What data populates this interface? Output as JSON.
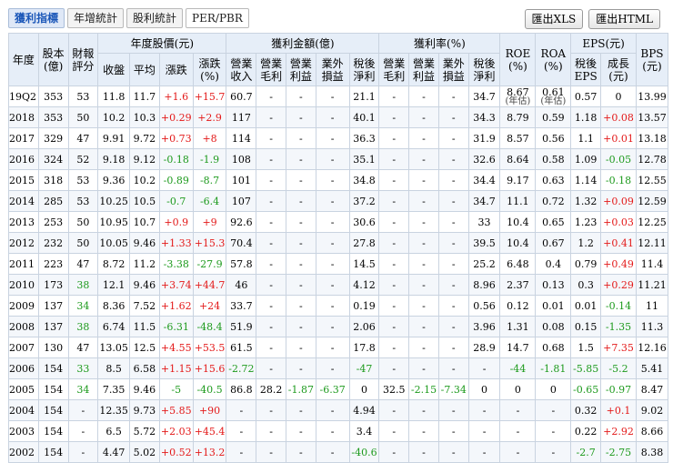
{
  "tabs": [
    {
      "label": "獲利指標",
      "active": true
    },
    {
      "label": "年增統計",
      "active": false
    },
    {
      "label": "股利統計",
      "active": false
    },
    {
      "label": "PER/PBR",
      "active": false
    }
  ],
  "actions": {
    "xls_label": "匯出XLS",
    "html_label": "匯出HTML"
  },
  "header": {
    "year": "年度",
    "capital": [
      "股本",
      "(億)"
    ],
    "rating": [
      "財報",
      "評分"
    ],
    "price_group": "年度股價(元)",
    "price_close": "收盤",
    "price_avg": "平均",
    "price_chg": "漲跌",
    "price_pct": [
      "漲跌",
      "(%)"
    ],
    "profit_group": "獲利金額(億)",
    "profit_rate_group": "獲利率(%)",
    "revenue": [
      "營業",
      "收入"
    ],
    "gross": [
      "營業",
      "毛利"
    ],
    "op": [
      "營業",
      "利益"
    ],
    "nonop": [
      "業外",
      "損益"
    ],
    "net": [
      "稅後",
      "淨利"
    ],
    "gross_r": [
      "營業",
      "毛利"
    ],
    "op_r": [
      "營業",
      "利益"
    ],
    "nonop_r": [
      "業外",
      "損益"
    ],
    "net_r": [
      "稅後",
      "淨利"
    ],
    "roe": [
      "ROE",
      "(%)"
    ],
    "roa": [
      "ROA",
      "(%)"
    ],
    "eps_group": "EPS(元)",
    "eps": [
      "稅後",
      "EPS"
    ],
    "eps_growth": [
      "成長",
      "(元)"
    ],
    "bps": [
      "BPS",
      "(元)"
    ]
  },
  "table": {
    "rows": [
      [
        "19Q2",
        "353",
        "53",
        "11.8",
        "11.7",
        "+1.6",
        "+15.7",
        "60.7",
        "-",
        "-",
        "-",
        "21.1",
        "-",
        "-",
        "-",
        "34.7",
        "8.67|(年估)",
        "0.61|(年估)",
        "0.57",
        "0",
        "13.99"
      ],
      [
        "2018",
        "353",
        "50",
        "10.2",
        "10.3",
        "+0.29",
        "+2.9",
        "117",
        "-",
        "-",
        "-",
        "40.1",
        "-",
        "-",
        "-",
        "34.3",
        "8.79",
        "0.59",
        "1.18",
        "+0.08",
        "13.57"
      ],
      [
        "2017",
        "329",
        "47",
        "9.91",
        "9.72",
        "+0.73",
        "+8",
        "114",
        "-",
        "-",
        "-",
        "36.3",
        "-",
        "-",
        "-",
        "31.9",
        "8.57",
        "0.56",
        "1.1",
        "+0.01",
        "13.18"
      ],
      [
        "2016",
        "324",
        "52",
        "9.18",
        "9.12",
        "-0.18",
        "-1.9",
        "108",
        "-",
        "-",
        "-",
        "35.1",
        "-",
        "-",
        "-",
        "32.6",
        "8.64",
        "0.58",
        "1.09",
        "-0.05",
        "12.78"
      ],
      [
        "2015",
        "318",
        "53",
        "9.36",
        "10.2",
        "-0.89",
        "-8.7",
        "101",
        "-",
        "-",
        "-",
        "34.8",
        "-",
        "-",
        "-",
        "34.4",
        "9.17",
        "0.63",
        "1.14",
        "-0.18",
        "12.55"
      ],
      [
        "2014",
        "285",
        "53",
        "10.25",
        "10.5",
        "-0.7",
        "-6.4",
        "107",
        "-",
        "-",
        "-",
        "37.2",
        "-",
        "-",
        "-",
        "34.7",
        "11.1",
        "0.72",
        "1.32",
        "+0.09",
        "12.59"
      ],
      [
        "2013",
        "253",
        "50",
        "10.95",
        "10.7",
        "+0.9",
        "+9",
        "92.6",
        "-",
        "-",
        "-",
        "30.6",
        "-",
        "-",
        "-",
        "33",
        "10.4",
        "0.65",
        "1.23",
        "+0.03",
        "12.25"
      ],
      [
        "2012",
        "232",
        "50",
        "10.05",
        "9.46",
        "+1.33",
        "+15.3",
        "70.4",
        "-",
        "-",
        "-",
        "27.8",
        "-",
        "-",
        "-",
        "39.5",
        "10.4",
        "0.67",
        "1.2",
        "+0.41",
        "12.11"
      ],
      [
        "2011",
        "223",
        "47",
        "8.72",
        "11.2",
        "-3.38",
        "-27.9",
        "57.8",
        "-",
        "-",
        "-",
        "14.5",
        "-",
        "-",
        "-",
        "25.2",
        "6.48",
        "0.4",
        "0.79",
        "+0.49",
        "11.4"
      ],
      [
        "2010",
        "173",
        "38",
        "12.1",
        "9.46",
        "+3.74",
        "+44.7",
        "46",
        "-",
        "-",
        "-",
        "4.12",
        "-",
        "-",
        "-",
        "8.96",
        "2.37",
        "0.13",
        "0.3",
        "+0.29",
        "11.21"
      ],
      [
        "2009",
        "137",
        "34",
        "8.36",
        "7.52",
        "+1.62",
        "+24",
        "33.7",
        "-",
        "-",
        "-",
        "0.19",
        "-",
        "-",
        "-",
        "0.56",
        "0.12",
        "0.01",
        "0.01",
        "-0.14",
        "11"
      ],
      [
        "2008",
        "137",
        "38",
        "6.74",
        "11.5",
        "-6.31",
        "-48.4",
        "51.9",
        "-",
        "-",
        "-",
        "2.06",
        "-",
        "-",
        "-",
        "3.96",
        "1.31",
        "0.08",
        "0.15",
        "-1.35",
        "11.3"
      ],
      [
        "2007",
        "130",
        "47",
        "13.05",
        "12.5",
        "+4.55",
        "+53.5",
        "61.5",
        "-",
        "-",
        "-",
        "17.8",
        "-",
        "-",
        "-",
        "28.9",
        "14.7",
        "0.68",
        "1.5",
        "+7.35",
        "12.16"
      ],
      [
        "2006",
        "154",
        "33",
        "8.5",
        "6.58",
        "+1.15",
        "+15.6",
        "-2.72",
        "-",
        "-",
        "-",
        "-47",
        "-",
        "-",
        "-",
        "-",
        "-44",
        "-1.81",
        "-5.85",
        "-5.2",
        "5.41"
      ],
      [
        "2005",
        "154",
        "34",
        "7.35",
        "9.46",
        "-5",
        "-40.5",
        "86.8",
        "28.2",
        "-1.87",
        "-6.37",
        "0",
        "32.5",
        "-2.15",
        "-7.34",
        "0",
        "0",
        "0",
        "-0.65",
        "-0.97",
        "8.47"
      ],
      [
        "2004",
        "154",
        "-",
        "12.35",
        "9.73",
        "+5.85",
        "+90",
        "-",
        "-",
        "-",
        "-",
        "4.94",
        "-",
        "-",
        "-",
        "-",
        "-",
        "-",
        "0.32",
        "+0.1",
        "9.02"
      ],
      [
        "2003",
        "154",
        "-",
        "6.5",
        "5.72",
        "+2.03",
        "+45.4",
        "-",
        "-",
        "-",
        "-",
        "3.4",
        "-",
        "-",
        "-",
        "-",
        "-",
        "-",
        "0.22",
        "+2.92",
        "8.66"
      ],
      [
        "2002",
        "154",
        "-",
        "4.47",
        "5.02",
        "+0.52",
        "+13.2",
        "-",
        "-",
        "-",
        "-",
        "-40.6",
        "-",
        "-",
        "-",
        "-",
        "-",
        "-",
        "-2.7",
        "-2.75",
        "8.38"
      ]
    ]
  },
  "colors": {
    "up": "#e31919",
    "down": "#1d9a1d",
    "header_bg": "#e6eef8",
    "tab_active": "#1a56b8"
  }
}
